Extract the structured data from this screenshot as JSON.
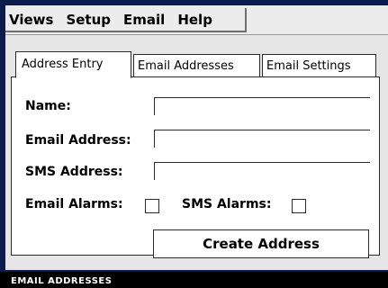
{
  "menubar": {
    "items": [
      "Views",
      "Setup",
      "Email",
      "Help"
    ]
  },
  "tabs": [
    "Address Entry",
    "Email Addresses",
    "Email Settings"
  ],
  "form": {
    "name_label": "Name:",
    "name_value": "",
    "email_label": "Email Address:",
    "email_value": "",
    "sms_label": "SMS Address:",
    "sms_value": "",
    "email_alarms_label": "Email Alarms:",
    "sms_alarms_label": "SMS Alarms:",
    "create_button": "Create Address"
  },
  "status": {
    "text": "EMAIL ADDRESSES"
  },
  "colors": {
    "frame": "#0b1c4a",
    "window": "#e6e6e6",
    "panel": "#ffffff"
  }
}
